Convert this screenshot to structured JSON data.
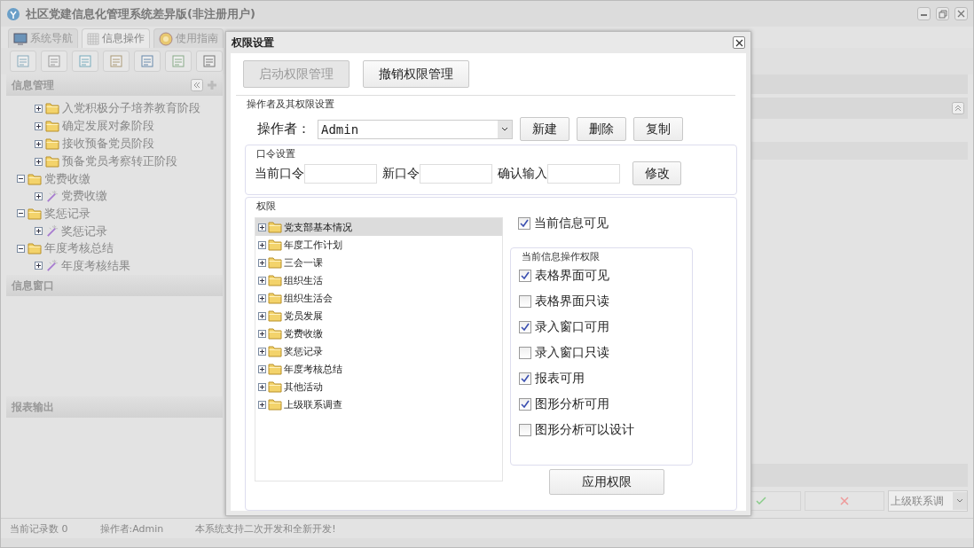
{
  "window": {
    "title": "社区党建信息化管理系统差异版(非注册用户)"
  },
  "tabs": [
    {
      "label": "系统导航",
      "selected": false,
      "kind": "monitor"
    },
    {
      "label": "信息操作",
      "selected": true,
      "kind": "grid"
    },
    {
      "label": "使用指南",
      "selected": false,
      "kind": "help"
    }
  ],
  "sidebar": {
    "title": "信息管理",
    "tree": [
      {
        "children": [
          {
            "label": "入党积极分子培养教育阶段",
            "kind": "folder",
            "expanded": false
          },
          {
            "label": "确定发展对象阶段",
            "kind": "folder",
            "expanded": false
          },
          {
            "label": "接收预备党员阶段",
            "kind": "folder",
            "expanded": false
          },
          {
            "label": "预备党员考察转正阶段",
            "kind": "folder",
            "expanded": false
          }
        ]
      },
      {
        "label": "党费收缴",
        "kind": "folder",
        "expanded": true,
        "children": [
          {
            "label": "党费收缴",
            "kind": "item",
            "expanded": false
          }
        ]
      },
      {
        "label": "奖惩记录",
        "kind": "folder",
        "expanded": true,
        "children": [
          {
            "label": "奖惩记录",
            "kind": "item",
            "expanded": false
          }
        ]
      },
      {
        "label": "年度考核总结",
        "kind": "folder",
        "expanded": true,
        "children": [
          {
            "label": "年度考核结果",
            "kind": "item",
            "expanded": false
          }
        ]
      }
    ]
  },
  "panels": [
    {
      "title": "信息窗口"
    },
    {
      "title": "报表输出"
    }
  ],
  "action_bar": {
    "dropdown": "上级联系调"
  },
  "status_bar": [
    "当前记录数 0",
    "操作者:Admin",
    "本系统支持二次开发和全新开发!"
  ],
  "dialog": {
    "title": "权限设置",
    "top_buttons": [
      {
        "label": "启动权限管理",
        "disabled": true
      },
      {
        "label": "撤销权限管理",
        "disabled": false
      }
    ],
    "operator_section": {
      "title": "操作者及其权限设置",
      "label": "操作者：",
      "value": "Admin",
      "buttons": [
        "新建",
        "删除",
        "复制"
      ]
    },
    "password_section": {
      "title": "口令设置",
      "fields": [
        {
          "label": "当前口令"
        },
        {
          "label": "新口令"
        },
        {
          "label": "确认输入"
        }
      ],
      "button": "修改"
    },
    "permissions": {
      "title": "权限",
      "tree": [
        {
          "label": "党支部基本情况",
          "selected": true
        },
        {
          "label": "年度工作计划",
          "selected": false
        },
        {
          "label": "三会一课",
          "selected": false
        },
        {
          "label": "组织生活",
          "selected": false
        },
        {
          "label": "组织生活会",
          "selected": false
        },
        {
          "label": "党员发展",
          "selected": false
        },
        {
          "label": "党费收缴",
          "selected": false
        },
        {
          "label": "奖惩记录",
          "selected": false
        },
        {
          "label": "年度考核总结",
          "selected": false
        },
        {
          "label": "其他活动",
          "selected": false
        },
        {
          "label": "上级联系调查",
          "selected": false
        }
      ],
      "visible": {
        "label": "当前信息可见",
        "checked": true
      },
      "ops_title": "当前信息操作权限",
      "options": [
        {
          "label": "表格界面可见",
          "checked": true
        },
        {
          "label": "表格界面只读",
          "checked": false
        },
        {
          "label": "录入窗口可用",
          "checked": true
        },
        {
          "label": "录入窗口只读",
          "checked": false
        },
        {
          "label": "报表可用",
          "checked": true
        },
        {
          "label": "图形分析可用",
          "checked": true
        },
        {
          "label": "图形分析可以设计",
          "checked": false
        }
      ],
      "apply": "应用权限"
    }
  }
}
